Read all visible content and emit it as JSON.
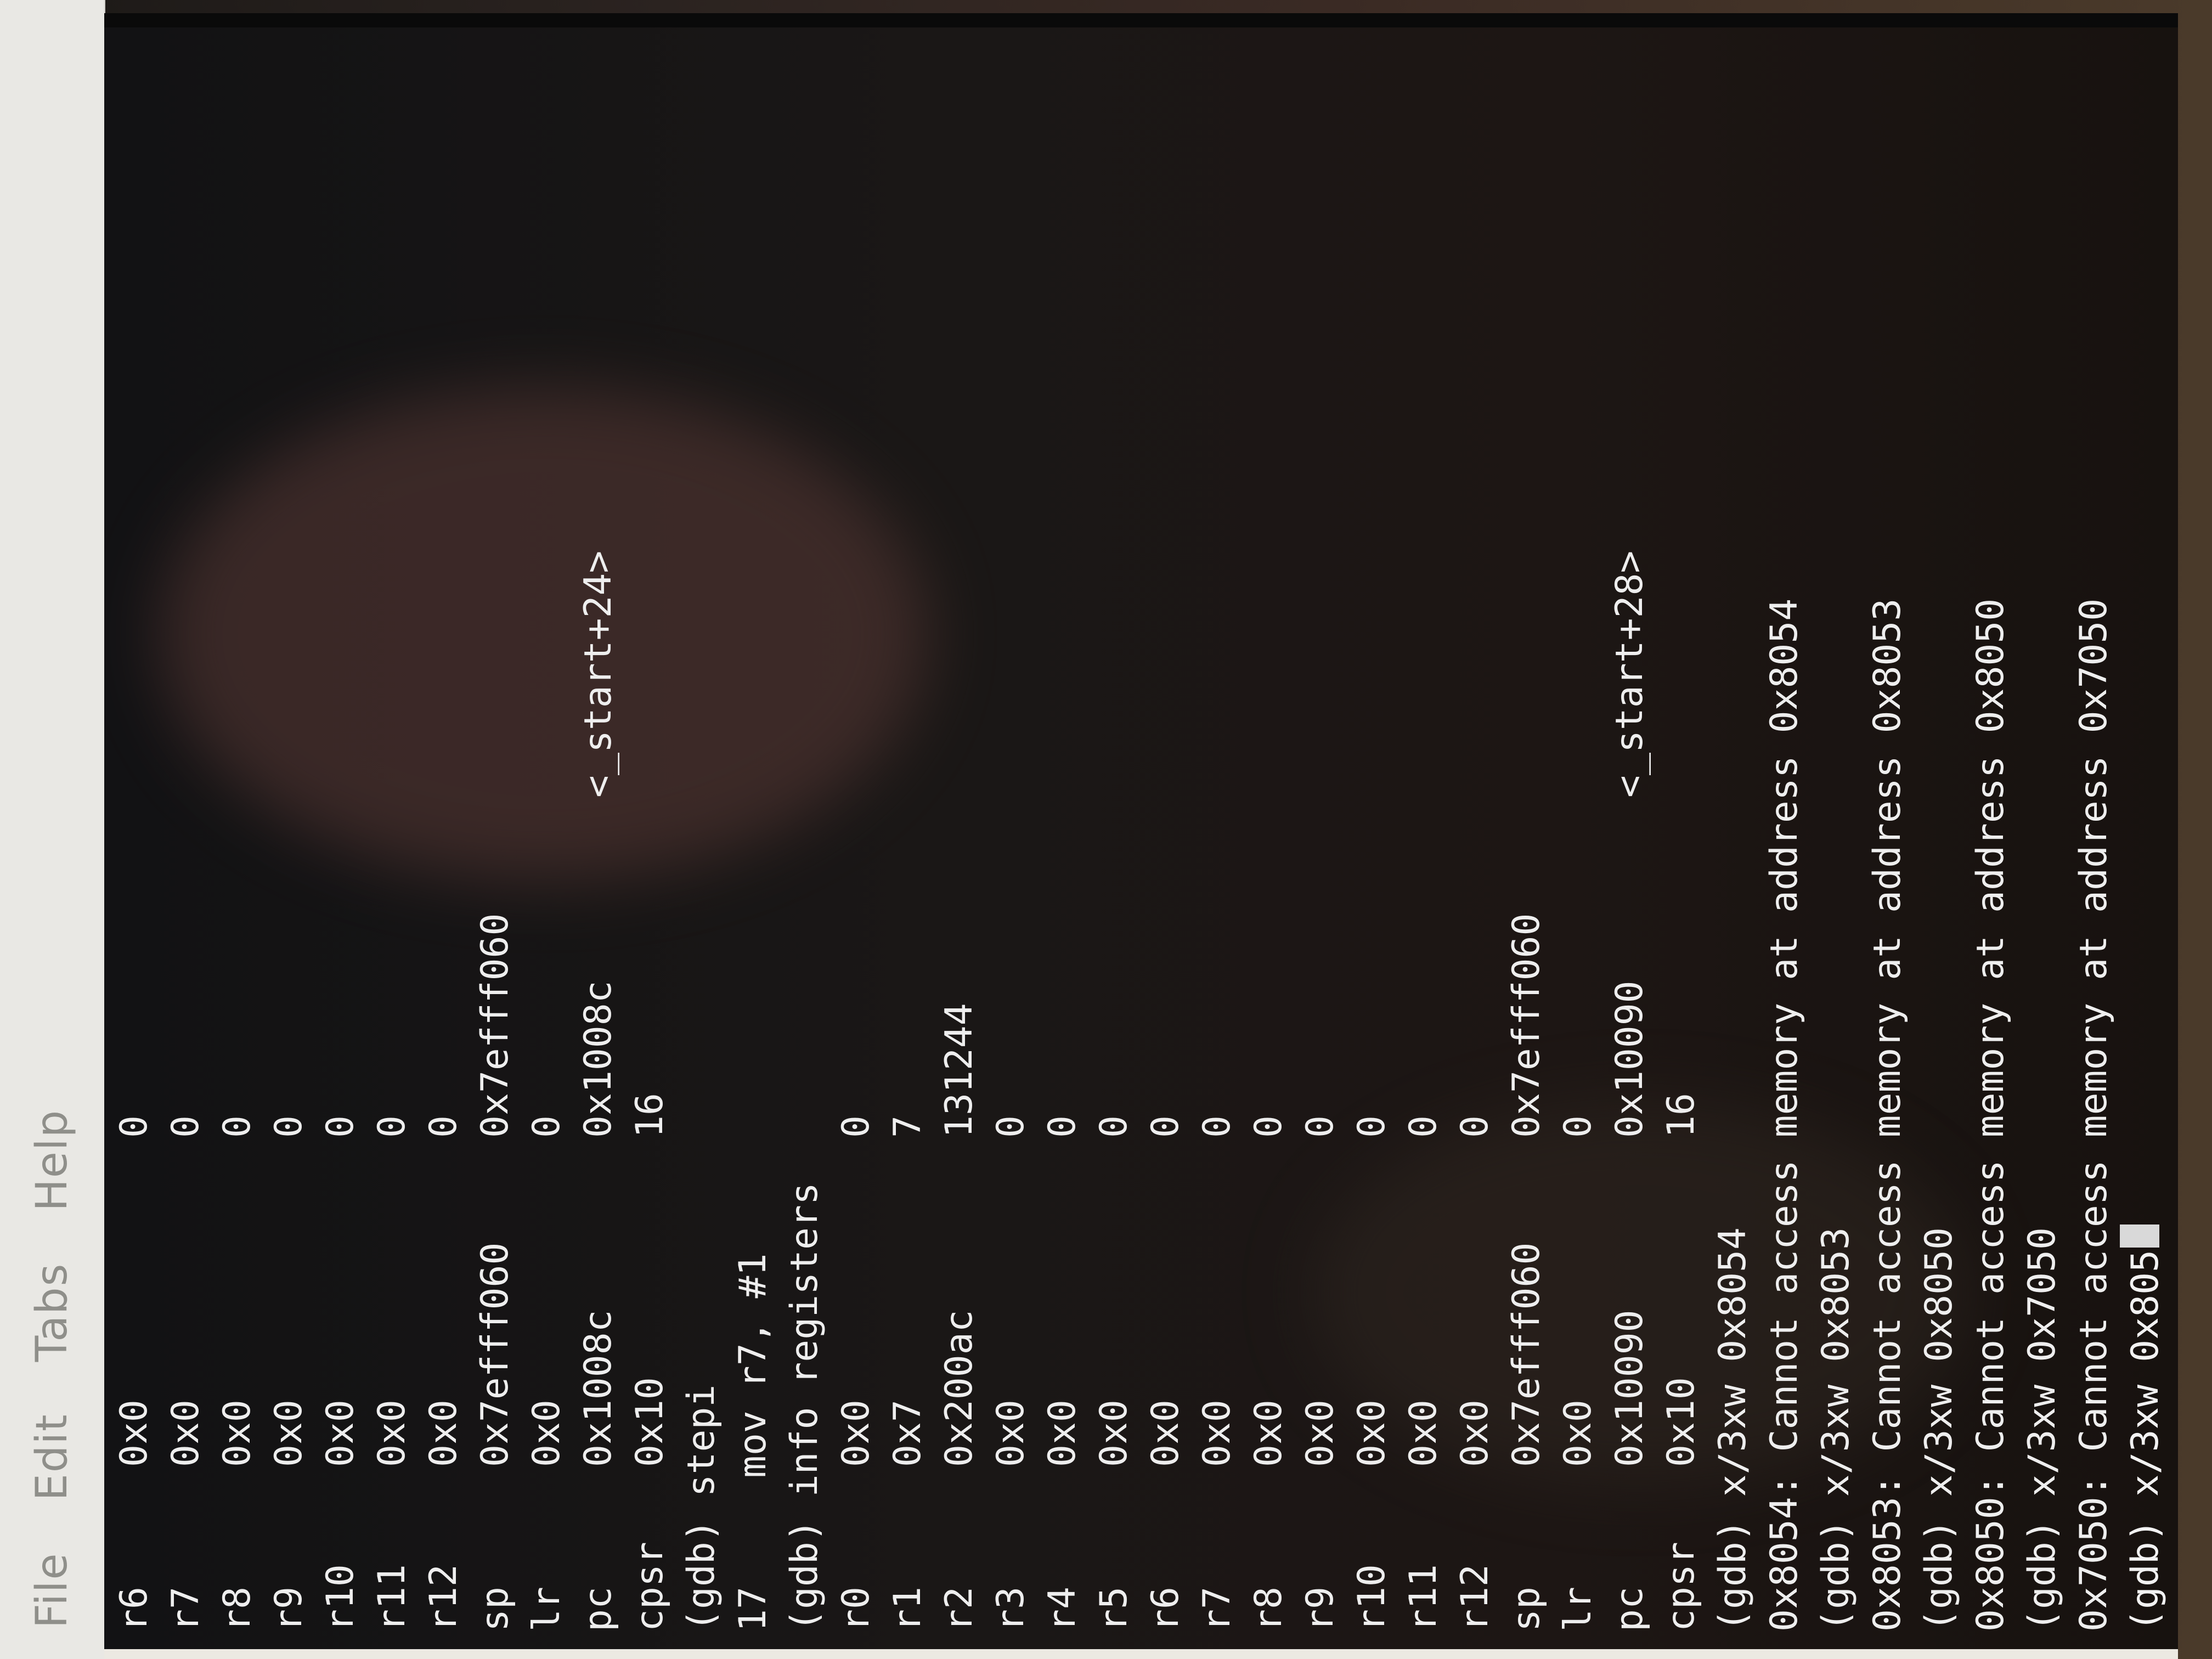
{
  "menubar": {
    "items": [
      "File",
      "Edit",
      "Tabs",
      "Help"
    ]
  },
  "terminal": {
    "lines": [
      [
        "r6",
        "0x0",
        "0",
        ""
      ],
      [
        "r7",
        "0x0",
        "0",
        ""
      ],
      [
        "r8",
        "0x0",
        "0",
        ""
      ],
      [
        "r9",
        "0x0",
        "0",
        ""
      ],
      [
        "r10",
        "0x0",
        "0",
        ""
      ],
      [
        "r11",
        "0x0",
        "0",
        ""
      ],
      [
        "r12",
        "0x0",
        "0",
        ""
      ],
      [
        "sp",
        "0x7efff060",
        "0x7efff060",
        ""
      ],
      [
        "lr",
        "0x0",
        "0",
        ""
      ],
      [
        "pc",
        "0x1008c",
        "0x1008c",
        "<_start+24>"
      ],
      [
        "cpsr",
        "0x10",
        "16",
        ""
      ],
      [
        "(gdb) stepi",
        "",
        "",
        ""
      ],
      [
        "17",
        "mov r7, #1",
        "",
        ""
      ],
      [
        "(gdb) info registers",
        "",
        "",
        ""
      ],
      [
        "r0",
        "0x0",
        "0",
        ""
      ],
      [
        "r1",
        "0x7",
        "7",
        ""
      ],
      [
        "r2",
        "0x200ac",
        "131244",
        ""
      ],
      [
        "r3",
        "0x0",
        "0",
        ""
      ],
      [
        "r4",
        "0x0",
        "0",
        ""
      ],
      [
        "r5",
        "0x0",
        "0",
        ""
      ],
      [
        "r6",
        "0x0",
        "0",
        ""
      ],
      [
        "r7",
        "0x0",
        "0",
        ""
      ],
      [
        "r8",
        "0x0",
        "0",
        ""
      ],
      [
        "r9",
        "0x0",
        "0",
        ""
      ],
      [
        "r10",
        "0x0",
        "0",
        ""
      ],
      [
        "r11",
        "0x0",
        "0",
        ""
      ],
      [
        "r12",
        "0x0",
        "0",
        ""
      ],
      [
        "sp",
        "0x7efff060",
        "0x7efff060",
        ""
      ],
      [
        "lr",
        "0x0",
        "0",
        ""
      ],
      [
        "pc",
        "0x10090",
        "0x10090",
        "<_start+28>"
      ],
      [
        "cpsr",
        "0x10",
        "16",
        ""
      ],
      [
        "(gdb) x/3xw 0x8054",
        "",
        "",
        ""
      ],
      [
        "0x8054: Cannot access memory at address 0x8054",
        "",
        "",
        ""
      ],
      [
        "(gdb) x/3xw 0x8053",
        "",
        "",
        ""
      ],
      [
        "0x8053: Cannot access memory at address 0x8053",
        "",
        "",
        ""
      ],
      [
        "(gdb) x/3xw 0x8050",
        "",
        "",
        ""
      ],
      [
        "0x8050: Cannot access memory at address 0x8050",
        "",
        "",
        ""
      ],
      [
        "(gdb) x/3xw 0x7050",
        "",
        "",
        ""
      ],
      [
        "0x7050: Cannot access memory at address 0x7050",
        "",
        "",
        ""
      ]
    ],
    "input_line": "(gdb) x/3xw 0x805"
  }
}
